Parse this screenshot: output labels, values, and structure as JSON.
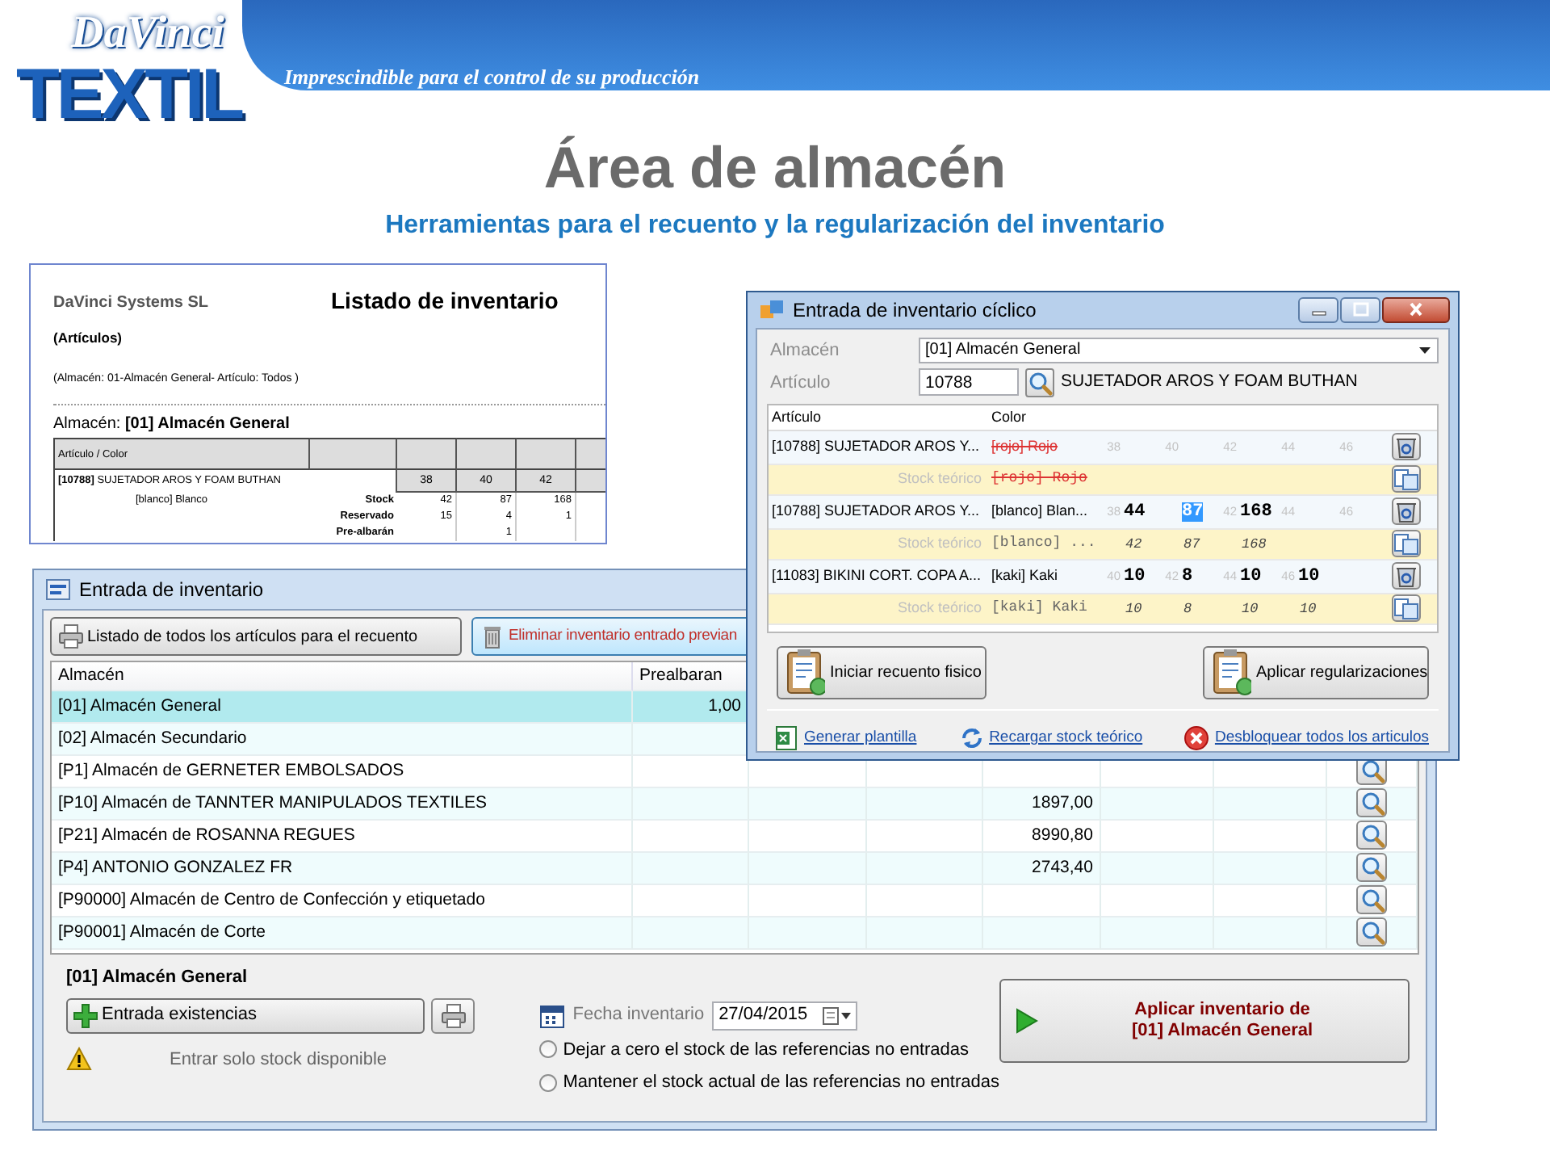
{
  "header": {
    "logo_small": "DaVinci",
    "logo_large": "TEXTIL",
    "tagline": "Imprescindible para el control de su producción"
  },
  "title": "Área de almacén",
  "subtitle": "Herramientas para el recuento y la regularización del inventario",
  "report": {
    "company": "DaVinci Systems SL",
    "title": "Listado de inventario",
    "subtitle": "(Artículos)",
    "filter": "(Almacén: 01-Almacén General- Artículo: Todos )",
    "warehouse": "Almacén: **[01] Almacén General**",
    "column": "Artículo / Color",
    "article": "**[10788]** SUJETADOR AROS Y FOAM BUTHAN",
    "sizes": [
      "38",
      "40",
      "42"
    ],
    "color_label": "[blanco] Blanco",
    "lines": [
      {
        "label": "Stock",
        "values": {
          "38": "42",
          "40": "87",
          "42": "168"
        }
      },
      {
        "label": "Reservado",
        "values": {
          "38": "15",
          "40": "4",
          "42": "1"
        }
      },
      {
        "label": "Pre-albarán",
        "values": {
          "40": "1"
        }
      }
    ]
  },
  "main_window": {
    "title": "Entrada de inventario",
    "toolbar": [
      {
        "kind": "print",
        "label": "Listado de todos los artículos para el recuento"
      },
      {
        "kind": "delete",
        "label": "Eliminar inventario entrado previan"
      }
    ],
    "columns": [
      "Almacén",
      "Prealbaran"
    ],
    "rows": [
      {
        "almacen": "[01] Almacén General",
        "prealbaran": "1,00",
        "selected": true
      },
      {
        "almacen": "[02] Almacén Secundario",
        "selected": false
      },
      {
        "almacen": "[P1] Almacén de GERNETER EMBOLSADOS",
        "selected": false
      },
      {
        "almacen": "[P10] Almacén de TANNTER MANIPULADOS TEXTILES",
        "column_5": "1897,00",
        "selected": false
      },
      {
        "almacen": "[P21] Almacén de ROSANNA REGUES",
        "column_5": "8990,80",
        "selected": false
      },
      {
        "almacen": "[P4] ANTONIO GONZALEZ FR",
        "column_5": "2743,40",
        "selected": false
      },
      {
        "almacen": "[P90000] Almacén de Centro de Confección y etiquetado",
        "selected": false
      },
      {
        "almacen": "[P90001] Almacén de Corte",
        "selected": false
      }
    ],
    "panel": {
      "heading": "[01] Almacén General",
      "entry_button": "Entrada existencias",
      "warning": "Entrar solo stock disponible",
      "date_label": "Fecha inventario",
      "date_value": "27/04/2015",
      "options": [
        {
          "label": "Dejar a cero el stock de las referencias no entradas",
          "selected": false
        },
        {
          "label": "Mantener el stock actual de las referencias no entradas",
          "selected": false
        }
      ],
      "apply_button": "Aplicar inventario de\n[01] Almacén General"
    }
  },
  "cyclic_window": {
    "title": "Entrada de inventario cíclico",
    "almacen_label": "Almacén",
    "almacen_value": "[01] Almacén General",
    "articulo_label": "Artículo",
    "articulo_value": "10788",
    "articulo_name": "SUJETADOR AROS Y FOAM BUTHAN",
    "columns": [
      "Artículo",
      "Color"
    ],
    "rows": [
      {
        "kind": "article",
        "articulo": "[10788] SUJETADOR AROS Y...",
        "color_label": "[rojo] Rojo",
        "crossed_out": true,
        "slots": [
          {
            "size": "38",
            "selected": false
          },
          {
            "size": "40",
            "selected": false
          },
          {
            "size": "42",
            "selected": false
          },
          {
            "size": "44",
            "selected": false
          },
          {
            "size": "46",
            "selected": false
          }
        ]
      },
      {
        "kind": "stock",
        "label": "Stock teórico",
        "color_label": "[rojo] Rojo",
        "crossed_out": true
      },
      {
        "kind": "article",
        "articulo": "[10788] SUJETADOR AROS Y...",
        "color_label": "[blanco] Blan...",
        "crossed_out": false,
        "slots": [
          {
            "size": "38",
            "qty": "44",
            "selected": false
          },
          {
            "qty": "87",
            "selected": true
          },
          {
            "size": "42",
            "qty": "168",
            "selected": false
          },
          {
            "size": "44",
            "selected": false
          },
          {
            "size": "46",
            "selected": false
          }
        ]
      },
      {
        "kind": "stock",
        "label": "Stock teórico",
        "color_label": "[blanco] ...",
        "crossed_out": false,
        "values": [
          "42",
          "87",
          "168"
        ]
      },
      {
        "kind": "article",
        "articulo": "[11083] BIKINI CORT. COPA A...",
        "color_label": "[kaki] Kaki",
        "crossed_out": false,
        "slots": [
          {
            "size": "40",
            "qty": "10",
            "selected": false
          },
          {
            "size": "42",
            "qty": "8",
            "selected": false
          },
          {
            "size": "44",
            "qty": "10",
            "selected": false
          },
          {
            "size": "46",
            "qty": "10",
            "selected": false
          }
        ]
      },
      {
        "kind": "stock",
        "label": "Stock teórico",
        "color_label": "[kaki] Kaki",
        "crossed_out": false,
        "values": [
          "10",
          "8",
          "10",
          "10"
        ]
      }
    ],
    "buttons": [
      "Iniciar recuento fisico",
      "Aplicar regularizaciones"
    ],
    "links": [
      {
        "kind": "excel",
        "label": "Generar plantilla"
      },
      {
        "kind": "reload",
        "label": "Recargar stock teórico"
      },
      {
        "kind": "unlock",
        "label": "Desbloquear todos los articulos"
      }
    ]
  }
}
